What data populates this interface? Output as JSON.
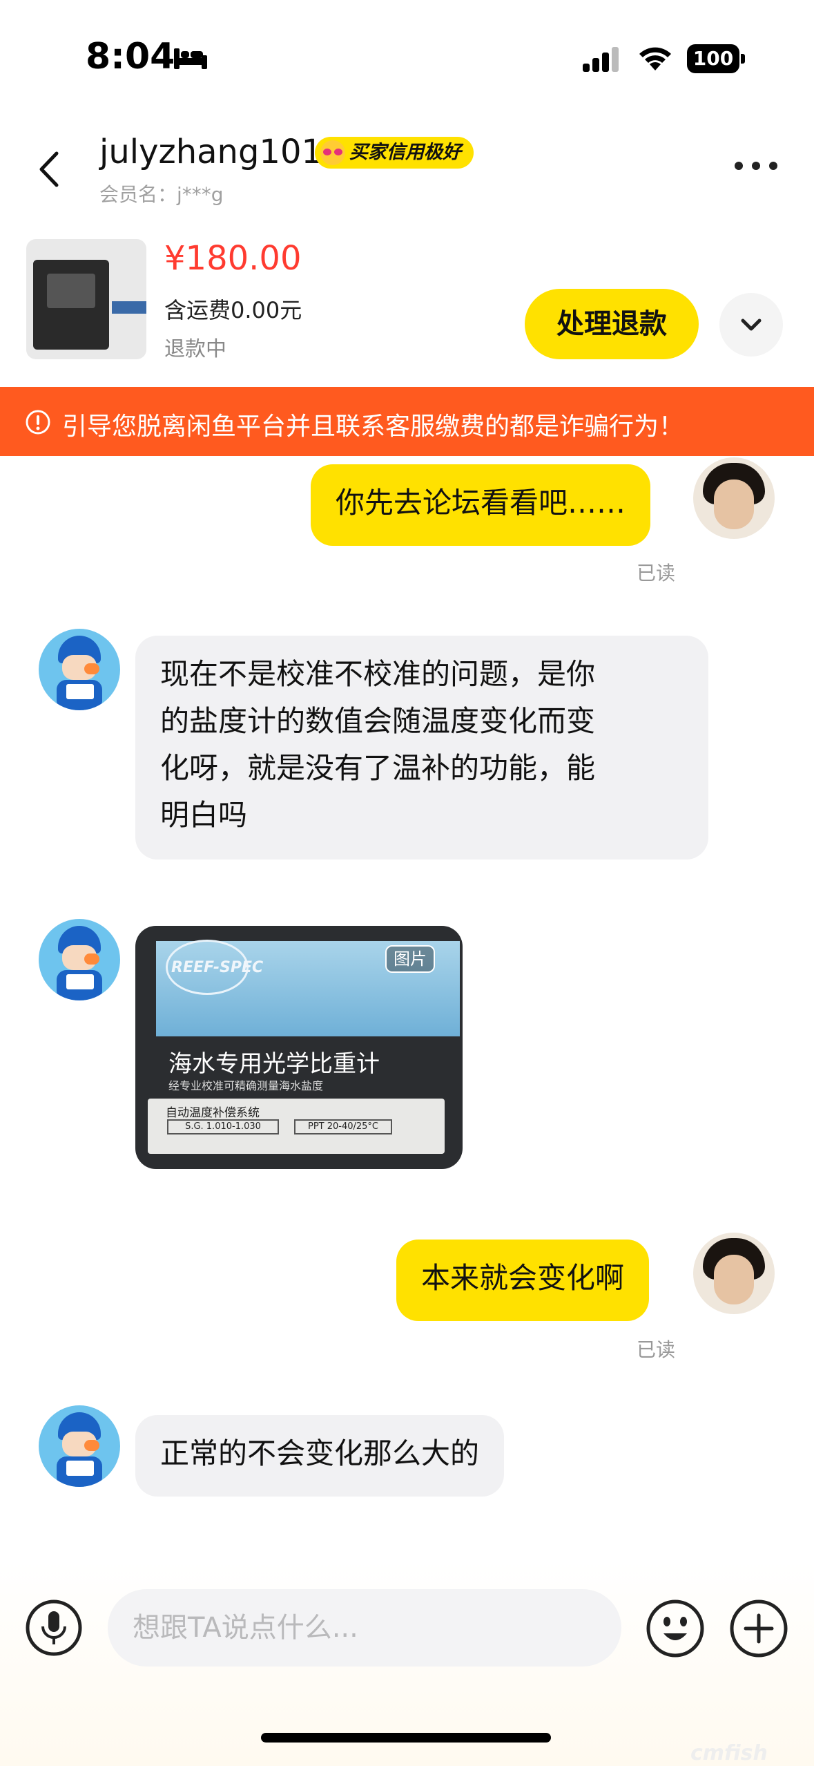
{
  "status_bar": {
    "time": "8:04",
    "battery": "100"
  },
  "header": {
    "username": "julyzhang101",
    "credit_badge": "买家信用极好",
    "member_label": "会员名：j***g"
  },
  "product": {
    "price": "¥180.00",
    "shipping": "含运费0.00元",
    "status": "退款中",
    "refund_button": "处理退款"
  },
  "warning": {
    "text": "引导您脱离闲鱼平台并且联系客服缴费的都是诈骗行为！"
  },
  "messages": [
    {
      "from": "me",
      "text": "你先去论坛看看吧……",
      "read": "已读"
    },
    {
      "from": "other",
      "lines": [
        "现在不是校准不校准的问题，是你",
        "的盐度计的数值会随温度变化而变",
        "化呀，就是没有了温补的功能，能",
        "明白吗"
      ]
    },
    {
      "from": "other",
      "type": "image",
      "tag": "图片",
      "logo": "REEF-SPEC",
      "title": "海水专用光学比重计",
      "subtitle": "经专业校准可精确测量海水盐度",
      "plate_title": "自动温度补偿系统",
      "spec1": "S.G. 1.010-1.030",
      "spec2": "PPT 20-40/25°C"
    },
    {
      "from": "me",
      "text": "本来就会变化啊",
      "read": "已读"
    },
    {
      "from": "other",
      "text": "正常的不会变化那么大的"
    }
  ],
  "input": {
    "placeholder": "想跟TA说点什么..."
  },
  "watermark": "cmfish",
  "colors": {
    "accent": "#ffe100",
    "warning": "#ff5a1f",
    "price": "#ff3b30"
  },
  "icons": [
    "back-icon",
    "more-icon",
    "chevron-down-icon",
    "warning-icon",
    "microphone-icon",
    "emoji-icon",
    "plus-icon",
    "bed-icon",
    "signal-icon",
    "wifi-icon"
  ]
}
